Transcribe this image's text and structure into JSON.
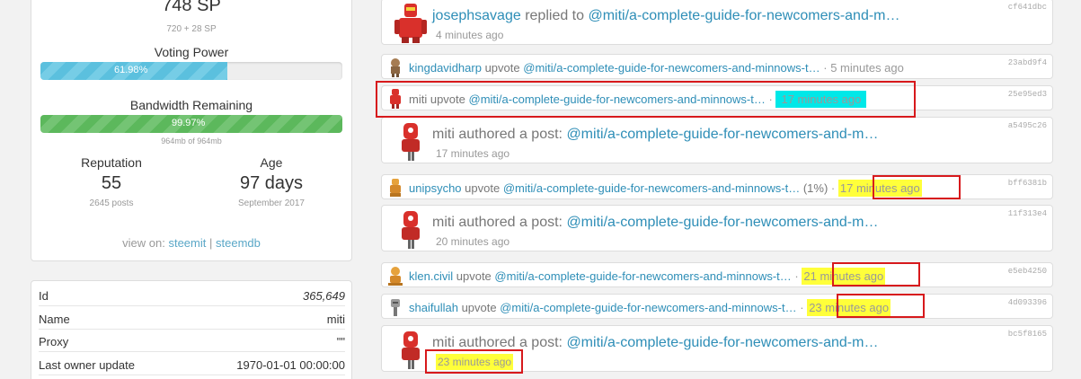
{
  "account": {
    "sp": "748 SP",
    "sp_sub": "720 + 28 SP",
    "voting_power_label": "Voting Power",
    "voting_power_text": "61.98%",
    "voting_power_pct": 61.98,
    "bandwidth_label": "Bandwidth Remaining",
    "bandwidth_text": "99.97%",
    "bandwidth_pct": 99.97,
    "bandwidth_sub": "964mb of 964mb",
    "reputation_label": "Reputation",
    "reputation_value": "55",
    "reputation_sub": "2645 posts",
    "age_label": "Age",
    "age_value": "97 days",
    "age_sub": "September 2017",
    "view_on_label": "view on:",
    "view_on_links": [
      "steemit",
      "steemdb"
    ],
    "separator": "|"
  },
  "properties": [
    {
      "key": "Id",
      "value": "365,649"
    },
    {
      "key": "Name",
      "value": "miti"
    },
    {
      "key": "Proxy",
      "value": "\"\""
    },
    {
      "key": "Last owner update",
      "value": "1970-01-01 00:00:00"
    }
  ],
  "activity": [
    {
      "user": "josephsavage",
      "action": "replied to",
      "link": "@miti/a-complete-guide-for-newcomers-and-m…",
      "time": "4 minutes ago",
      "hash": "cf641dbc",
      "avatar": "red-robot-avatar"
    },
    {
      "user": "kingdavidharp",
      "action": "upvote",
      "link": "@miti/a-complete-guide-for-newcomers-and-minnows-t…",
      "time": "5 minutes ago",
      "hash": "23abd9f4",
      "avatar": "bronze-robot-avatar"
    },
    {
      "user": "miti",
      "action": "upvote",
      "link": "@miti/a-complete-guide-for-newcomers-and-minnows-t…",
      "time": "17 minutes ago",
      "hash": "25e95ed3",
      "avatar": "red-robot-avatar"
    },
    {
      "user": "miti",
      "action": "authored a post:",
      "link": "@miti/a-complete-guide-for-newcomers-and-m…",
      "time": "17 minutes ago",
      "hash": "a5495c26",
      "avatar": "red-robot-avatar"
    },
    {
      "user": "unipsycho",
      "action": "upvote",
      "link": "@miti/a-complete-guide-for-newcomers-and-minnows-t…",
      "pct": "(1%)",
      "time": "17 minutes ago",
      "hash": "bff6381b",
      "avatar": "orange-robot-avatar"
    },
    {
      "user": "miti",
      "action": "authored a post:",
      "link": "@miti/a-complete-guide-for-newcomers-and-m…",
      "time": "20 minutes ago",
      "hash": "11f313e4",
      "avatar": "red-robot-avatar"
    },
    {
      "user": "klen.civil",
      "action": "upvote",
      "link": "@miti/a-complete-guide-for-newcomers-and-minnows-t…",
      "time": "21 minutes ago",
      "hash": "e5eb4250",
      "avatar": "orange-robot-avatar"
    },
    {
      "user": "shaifullah",
      "action": "upvote",
      "link": "@miti/a-complete-guide-for-newcomers-and-minnows-t…",
      "time": "23 minutes ago",
      "hash": "4d093396",
      "avatar": "grey-robot-avatar"
    },
    {
      "user": "miti",
      "action": "authored a post:",
      "link": "@miti/a-complete-guide-for-newcomers-and-m…",
      "time": "23 minutes ago",
      "hash": "bc5f8165",
      "avatar": "red-robot-avatar"
    }
  ],
  "colors": {
    "link": "#2e8eb7",
    "highlight_yellow": "#ffff3a",
    "highlight_cyan": "#00e8e8",
    "annotation_red": "#d7191c",
    "voting_bar": "#5bc0de",
    "bandwidth_bar": "#5cb85c"
  }
}
